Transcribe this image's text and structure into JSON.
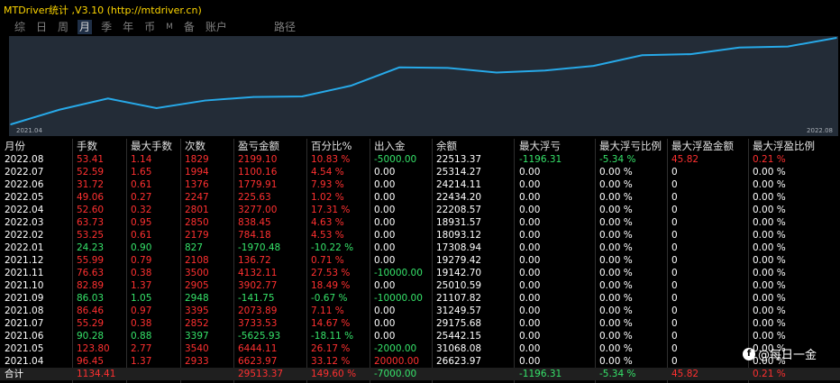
{
  "window": {
    "title": "MTDriver统计 ,V3.10 (http://mtdriver.cn)"
  },
  "colors": {
    "red": "#ff3030",
    "green": "#36e36a",
    "white": "#ffffff",
    "line": "#27a9e8"
  },
  "tabs": [
    {
      "label": "综",
      "active": false,
      "small": false
    },
    {
      "label": "日",
      "active": false,
      "small": false
    },
    {
      "label": "周",
      "active": false,
      "small": false
    },
    {
      "label": "月",
      "active": true,
      "small": false
    },
    {
      "label": "季",
      "active": false,
      "small": false
    },
    {
      "label": "年",
      "active": false,
      "small": false
    },
    {
      "label": "币",
      "active": false,
      "small": false
    },
    {
      "label": "M",
      "active": false,
      "small": true
    },
    {
      "label": "备",
      "active": false,
      "small": false
    },
    {
      "label": "账户",
      "active": false,
      "small": false
    }
  ],
  "path_tab": "路径",
  "chart_data": {
    "type": "line",
    "x_start_label": "2021.04",
    "x_end_label": "2022.08",
    "x": [
      "2021.04",
      "2021.05",
      "2021.06",
      "2021.07",
      "2021.08",
      "2021.09",
      "2021.10",
      "2021.11",
      "2021.12",
      "2022.01",
      "2022.02",
      "2022.03",
      "2022.04",
      "2022.05",
      "2022.06",
      "2022.07",
      "2022.08"
    ],
    "values": [
      6623.97,
      9500,
      11700,
      9800,
      11300,
      12000,
      12100,
      14200,
      17800,
      17700,
      16800,
      17200,
      18100,
      20200,
      20400,
      21700,
      21900,
      23600
    ],
    "ylim": [
      6623.97,
      23600
    ]
  },
  "table": {
    "headers": [
      "月份",
      "手数",
      "最大手数",
      "次数",
      "盈亏金额",
      "百分比%",
      "出入金",
      "余额",
      "最大浮亏",
      "最大浮亏比例",
      "最大浮盈金额",
      "最大浮盈比例"
    ],
    "rows": [
      {
        "cells": [
          "2022.08",
          "53.41",
          "1.14",
          "1829",
          "2199.10",
          "10.83 %",
          "-5000.00",
          "22513.37",
          "-1196.31",
          "-5.34 %",
          "45.82",
          "0.21 %"
        ],
        "colors": [
          "w",
          "r",
          "r",
          "r",
          "r",
          "r",
          "g",
          "w",
          "g",
          "g",
          "r",
          "r"
        ]
      },
      {
        "cells": [
          "2022.07",
          "52.59",
          "1.65",
          "1994",
          "1100.16",
          "4.54 %",
          "0.00",
          "25314.27",
          "0.00",
          "0.00 %",
          "0",
          "0.00 %"
        ],
        "colors": [
          "w",
          "r",
          "r",
          "r",
          "r",
          "r",
          "w",
          "w",
          "w",
          "w",
          "w",
          "w"
        ]
      },
      {
        "cells": [
          "2022.06",
          "31.72",
          "0.61",
          "1376",
          "1779.91",
          "7.93 %",
          "0.00",
          "24214.11",
          "0.00",
          "0.00 %",
          "0",
          "0.00 %"
        ],
        "colors": [
          "w",
          "r",
          "r",
          "r",
          "r",
          "r",
          "w",
          "w",
          "w",
          "w",
          "w",
          "w"
        ]
      },
      {
        "cells": [
          "2022.05",
          "49.06",
          "0.27",
          "2247",
          "225.63",
          "1.02 %",
          "0.00",
          "22434.20",
          "0.00",
          "0.00 %",
          "0",
          "0.00 %"
        ],
        "colors": [
          "w",
          "r",
          "r",
          "r",
          "r",
          "r",
          "w",
          "w",
          "w",
          "w",
          "w",
          "w"
        ]
      },
      {
        "cells": [
          "2022.04",
          "52.60",
          "0.32",
          "2801",
          "3277.00",
          "17.31 %",
          "0.00",
          "22208.57",
          "0.00",
          "0.00 %",
          "0",
          "0.00 %"
        ],
        "colors": [
          "w",
          "r",
          "r",
          "r",
          "r",
          "r",
          "w",
          "w",
          "w",
          "w",
          "w",
          "w"
        ]
      },
      {
        "cells": [
          "2022.03",
          "63.73",
          "0.95",
          "2850",
          "838.45",
          "4.63 %",
          "0.00",
          "18931.57",
          "0.00",
          "0.00 %",
          "0",
          "0.00 %"
        ],
        "colors": [
          "w",
          "r",
          "r",
          "r",
          "r",
          "r",
          "w",
          "w",
          "w",
          "w",
          "w",
          "w"
        ]
      },
      {
        "cells": [
          "2022.02",
          "53.25",
          "0.61",
          "2179",
          "784.18",
          "4.53 %",
          "0.00",
          "18093.12",
          "0.00",
          "0.00 %",
          "0",
          "0.00 %"
        ],
        "colors": [
          "w",
          "r",
          "r",
          "r",
          "r",
          "r",
          "w",
          "w",
          "w",
          "w",
          "w",
          "w"
        ]
      },
      {
        "cells": [
          "2022.01",
          "24.23",
          "0.90",
          "827",
          "-1970.48",
          "-10.22 %",
          "0.00",
          "17308.94",
          "0.00",
          "0.00 %",
          "0",
          "0.00 %"
        ],
        "colors": [
          "w",
          "g",
          "g",
          "g",
          "g",
          "g",
          "w",
          "w",
          "w",
          "w",
          "w",
          "w"
        ]
      },
      {
        "cells": [
          "2021.12",
          "55.99",
          "0.79",
          "2108",
          "136.72",
          "0.71 %",
          "0.00",
          "19279.42",
          "0.00",
          "0.00 %",
          "0",
          "0.00 %"
        ],
        "colors": [
          "w",
          "r",
          "r",
          "r",
          "r",
          "r",
          "w",
          "w",
          "w",
          "w",
          "w",
          "w"
        ]
      },
      {
        "cells": [
          "2021.11",
          "76.63",
          "0.38",
          "3500",
          "4132.11",
          "27.53 %",
          "-10000.00",
          "19142.70",
          "0.00",
          "0.00 %",
          "0",
          "0.00 %"
        ],
        "colors": [
          "w",
          "r",
          "r",
          "r",
          "r",
          "r",
          "g",
          "w",
          "w",
          "w",
          "w",
          "w"
        ]
      },
      {
        "cells": [
          "2021.10",
          "82.89",
          "1.37",
          "2905",
          "3902.77",
          "18.49 %",
          "0.00",
          "25010.59",
          "0.00",
          "0.00 %",
          "0",
          "0.00 %"
        ],
        "colors": [
          "w",
          "r",
          "r",
          "r",
          "r",
          "r",
          "w",
          "w",
          "w",
          "w",
          "w",
          "w"
        ]
      },
      {
        "cells": [
          "2021.09",
          "86.03",
          "1.05",
          "2948",
          "-141.75",
          "-0.67 %",
          "-10000.00",
          "21107.82",
          "0.00",
          "0.00 %",
          "0",
          "0.00 %"
        ],
        "colors": [
          "w",
          "g",
          "g",
          "g",
          "g",
          "g",
          "g",
          "w",
          "w",
          "w",
          "w",
          "w"
        ]
      },
      {
        "cells": [
          "2021.08",
          "86.46",
          "0.97",
          "3395",
          "2073.89",
          "7.11 %",
          "0.00",
          "31249.57",
          "0.00",
          "0.00 %",
          "0",
          "0.00 %"
        ],
        "colors": [
          "w",
          "r",
          "r",
          "r",
          "r",
          "r",
          "w",
          "w",
          "w",
          "w",
          "w",
          "w"
        ]
      },
      {
        "cells": [
          "2021.07",
          "55.29",
          "0.38",
          "2852",
          "3733.53",
          "14.67 %",
          "0.00",
          "29175.68",
          "0.00",
          "0.00 %",
          "0",
          "0.00 %"
        ],
        "colors": [
          "w",
          "r",
          "r",
          "r",
          "r",
          "r",
          "w",
          "w",
          "w",
          "w",
          "w",
          "w"
        ]
      },
      {
        "cells": [
          "2021.06",
          "90.28",
          "0.88",
          "3397",
          "-5625.93",
          "-18.11 %",
          "0.00",
          "25442.15",
          "0.00",
          "0.00 %",
          "0",
          "0.00 %"
        ],
        "colors": [
          "w",
          "g",
          "g",
          "g",
          "g",
          "g",
          "w",
          "w",
          "w",
          "w",
          "w",
          "w"
        ]
      },
      {
        "cells": [
          "2021.05",
          "123.80",
          "2.77",
          "3540",
          "6444.11",
          "26.17 %",
          "-2000.00",
          "31068.08",
          "0.00",
          "0.00 %",
          "0",
          "0.00 %"
        ],
        "colors": [
          "w",
          "r",
          "r",
          "r",
          "r",
          "r",
          "g",
          "w",
          "w",
          "w",
          "w",
          "w"
        ]
      },
      {
        "cells": [
          "2021.04",
          "96.45",
          "1.37",
          "2933",
          "6623.97",
          "33.12 %",
          "20000.00",
          "26623.97",
          "0.00",
          "0.00 %",
          "0",
          "0.00 %"
        ],
        "colors": [
          "w",
          "r",
          "r",
          "r",
          "r",
          "r",
          "r",
          "w",
          "w",
          "w",
          "w",
          "w"
        ]
      }
    ],
    "total": {
      "cells": [
        "合计",
        "1134.41",
        "",
        "",
        "29513.37",
        "149.60 %",
        "-7000.00",
        "",
        "-1196.31",
        "-5.34 %",
        "45.82",
        "0.21 %"
      ],
      "colors": [
        "w",
        "r",
        "w",
        "w",
        "r",
        "r",
        "g",
        "w",
        "g",
        "g",
        "r",
        "r"
      ]
    }
  },
  "watermark": {
    "icon": "f",
    "text": "@每日一金"
  }
}
